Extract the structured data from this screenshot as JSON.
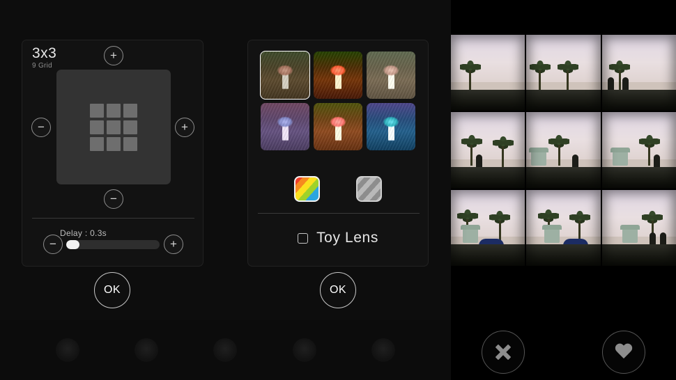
{
  "grid_panel": {
    "title": "3x3",
    "subtitle": "9 Grid",
    "plus_top_label": "+",
    "minus_left_label": "−",
    "plus_right_label": "+",
    "minus_bottom_label": "−",
    "delay_label": "Delay : 0.3s",
    "delay_minus_label": "−",
    "delay_plus_label": "+",
    "delay_value": "0.3s",
    "delay_fill_percent": 14,
    "grid_cells": 9,
    "ok_label": "OK"
  },
  "filter_panel": {
    "thumbnails": [
      {
        "name": "normal",
        "class": "f-normal",
        "selected": true
      },
      {
        "name": "vivid",
        "class": "f-vivid",
        "selected": false
      },
      {
        "name": "faded",
        "class": "f-faded",
        "selected": false
      },
      {
        "name": "purple",
        "class": "f-purple",
        "selected": false
      },
      {
        "name": "warm",
        "class": "f-warm",
        "selected": false
      },
      {
        "name": "blue",
        "class": "f-blue",
        "selected": false
      }
    ],
    "color_mode_icon": "color-swatch-icon",
    "mono_mode_icon": "grayscale-swatch-icon",
    "toy_lens_label": "Toy Lens",
    "toy_lens_checked": false,
    "ok_label": "OK"
  },
  "photo_grid": {
    "rows": 3,
    "columns": 3,
    "count": 9,
    "shots": [
      {
        "scene": "beach-palm-left"
      },
      {
        "scene": "beach-palms-pillar"
      },
      {
        "scene": "beach-palm-people"
      },
      {
        "scene": "palms-silhouette-a"
      },
      {
        "scene": "palms-silhouette-b"
      },
      {
        "scene": "palms-silhouette-c"
      },
      {
        "scene": "lifeguard-tower-tent-a"
      },
      {
        "scene": "lifeguard-tower-tent-b"
      },
      {
        "scene": "lifeguard-tower-flag"
      }
    ]
  },
  "actions": {
    "discard_icon": "close-x-icon",
    "favorite_icon": "heart-icon"
  },
  "colors": {
    "background": "#0d0d0d",
    "panel": "#121212",
    "accent_white": "#ffffff",
    "text_primary": "#e8e8e8",
    "text_secondary": "#8e8e8e",
    "slider_fill": "#f2f2f2",
    "icon_gray": "#8d8d8d"
  }
}
